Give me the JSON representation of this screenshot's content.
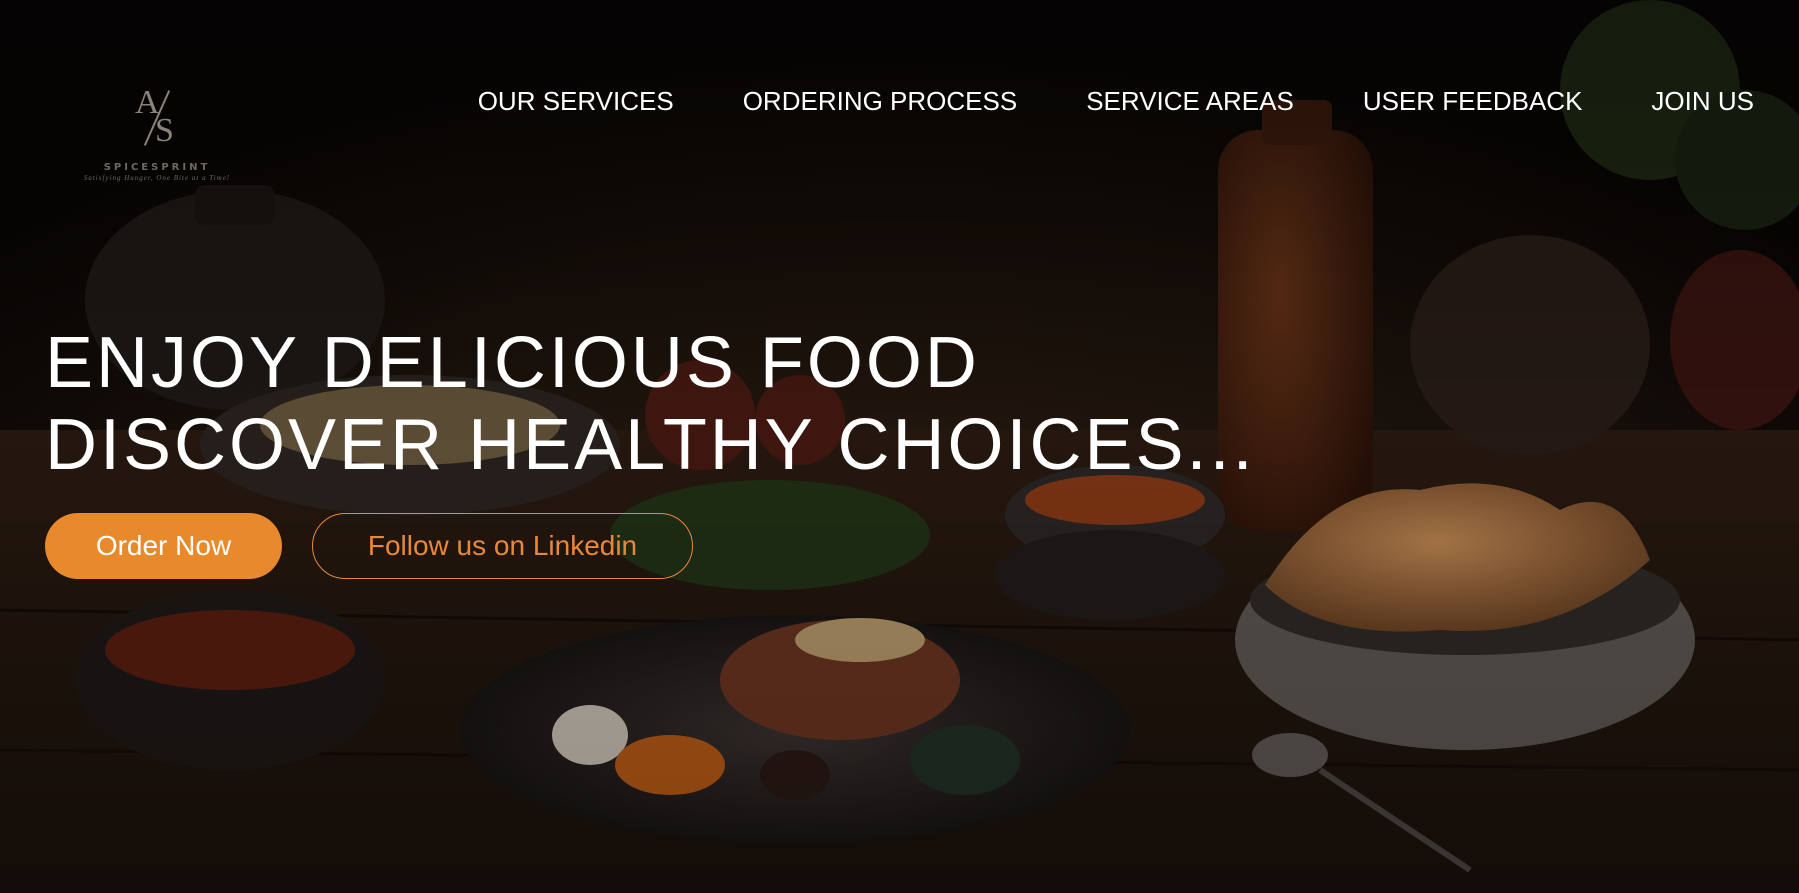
{
  "brand": {
    "logo_monogram_a": "A",
    "logo_monogram_s": "S",
    "name": "SPICESPRINT",
    "tagline": "Satisfying Hunger, One Bite at a Time!"
  },
  "nav": {
    "items": [
      {
        "label": "OUR SERVICES"
      },
      {
        "label": "ORDERING PROCESS"
      },
      {
        "label": "SERVICE AREAS"
      },
      {
        "label": "USER FEEDBACK"
      },
      {
        "label": "JOIN US"
      }
    ]
  },
  "hero": {
    "headline_line1": "ENJOY DELICIOUS FOOD",
    "headline_line2": "DISCOVER HEALTHY CHOICES...",
    "primary_cta": "Order Now",
    "secondary_cta": "Follow us on Linkedin"
  },
  "colors": {
    "accent": "#e88a2c",
    "text_light": "#ffffff",
    "background": "#0b0806"
  },
  "icons": {
    "background_image": "food-table-photo"
  }
}
